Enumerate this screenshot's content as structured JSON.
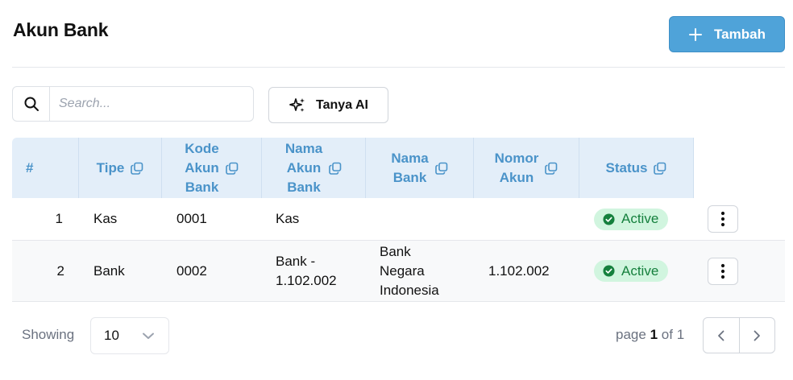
{
  "header": {
    "title": "Akun Bank",
    "add_label": "Tambah"
  },
  "toolbar": {
    "search_placeholder": "Search...",
    "ai_label": "Tanya AI"
  },
  "table": {
    "columns": [
      {
        "key": "no",
        "label": "#"
      },
      {
        "key": "tipe",
        "label": "Tipe"
      },
      {
        "key": "kode",
        "label": "Kode\nAkun\nBank"
      },
      {
        "key": "nama_akun",
        "label": "Nama\nAkun\nBank"
      },
      {
        "key": "nama_bank",
        "label": "Nama\nBank"
      },
      {
        "key": "nomor",
        "label": "Nomor\nAkun"
      },
      {
        "key": "status",
        "label": "Status"
      }
    ],
    "rows": [
      {
        "no": "1",
        "tipe": "Kas",
        "kode": "0001",
        "nama_akun": "Kas",
        "nama_bank": "",
        "nomor": "",
        "status": "Active"
      },
      {
        "no": "2",
        "tipe": "Bank",
        "kode": "0002",
        "nama_akun": "Bank -\n1.102.002",
        "nama_bank": "Bank\nNegara\nIndonesia",
        "nomor": "1.102.002",
        "status": "Active"
      }
    ]
  },
  "footer": {
    "showing_label": "Showing",
    "page_size": "10",
    "page_prefix": "page",
    "page_current": "1",
    "page_of": "of",
    "page_total": "1"
  },
  "colors": {
    "accent": "#4fa3d9",
    "header_bg": "#e3eef9",
    "header_text": "#4a93c9",
    "status_bg": "#d1f5df",
    "status_text": "#15803d"
  },
  "icons": {
    "add": "plus-icon",
    "search": "search-icon",
    "ai": "sparkles-icon",
    "copy": "copy-icon",
    "status": "check-circle-icon",
    "menu": "more-vertical-icon",
    "dropdown": "chevron-down-icon",
    "prev": "chevron-left-icon",
    "next": "chevron-right-icon"
  }
}
